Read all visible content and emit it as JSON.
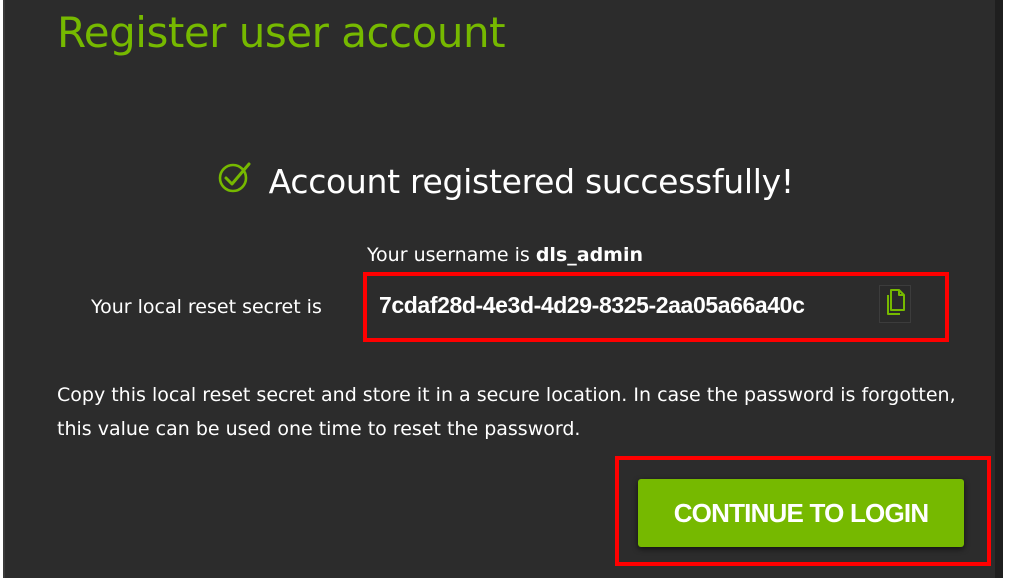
{
  "dialog": {
    "title": "Register user account",
    "success_message": "Account registered successfully!",
    "username_prefix": "Your username is ",
    "username": "dls_admin",
    "secret_label": "Your local reset secret is",
    "reset_secret": "7cdaf28d-4e3d-4d29-8325-2aa05a66a40c",
    "note": "Copy this local reset secret and store it in a secure location. In case the password is forgotten, this value can be used one time to reset the password.",
    "continue_label": "CONTINUE TO LOGIN"
  },
  "icons": {
    "success": "check-circle-icon",
    "copy": "copy-icon"
  },
  "colors": {
    "accent": "#76b900",
    "background": "#2c2c2c",
    "text": "#ffffff",
    "highlight": "#ff0000"
  }
}
